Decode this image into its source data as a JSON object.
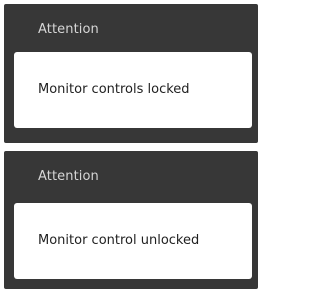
{
  "dialogs": [
    {
      "title": "Attention",
      "message": "Monitor controls locked"
    },
    {
      "title": "Attention",
      "message": "Monitor control unlocked"
    }
  ],
  "colors": {
    "panel_background": "#373737",
    "title_text": "#d6d6d6",
    "message_background": "#ffffff",
    "message_text": "#1f1f1f"
  }
}
